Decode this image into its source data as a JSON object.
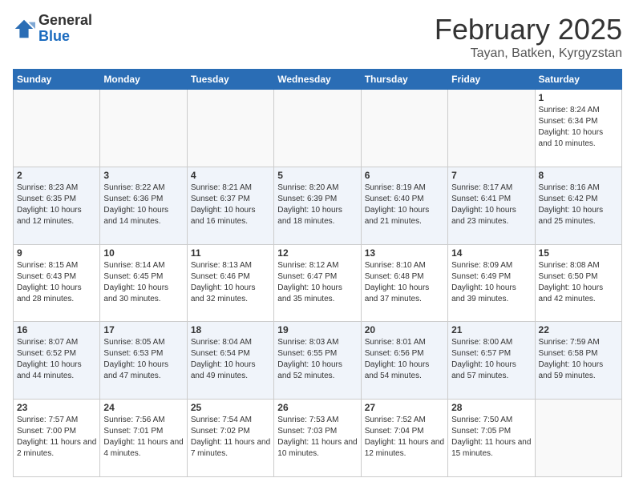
{
  "header": {
    "logo_general": "General",
    "logo_blue": "Blue",
    "month_title": "February 2025",
    "location": "Tayan, Batken, Kyrgyzstan"
  },
  "days_of_week": [
    "Sunday",
    "Monday",
    "Tuesday",
    "Wednesday",
    "Thursday",
    "Friday",
    "Saturday"
  ],
  "weeks": [
    {
      "alt": false,
      "days": [
        {
          "date": "",
          "info": ""
        },
        {
          "date": "",
          "info": ""
        },
        {
          "date": "",
          "info": ""
        },
        {
          "date": "",
          "info": ""
        },
        {
          "date": "",
          "info": ""
        },
        {
          "date": "",
          "info": ""
        },
        {
          "date": "1",
          "info": "Sunrise: 8:24 AM\nSunset: 6:34 PM\nDaylight: 10 hours\nand 10 minutes."
        }
      ]
    },
    {
      "alt": true,
      "days": [
        {
          "date": "2",
          "info": "Sunrise: 8:23 AM\nSunset: 6:35 PM\nDaylight: 10 hours\nand 12 minutes."
        },
        {
          "date": "3",
          "info": "Sunrise: 8:22 AM\nSunset: 6:36 PM\nDaylight: 10 hours\nand 14 minutes."
        },
        {
          "date": "4",
          "info": "Sunrise: 8:21 AM\nSunset: 6:37 PM\nDaylight: 10 hours\nand 16 minutes."
        },
        {
          "date": "5",
          "info": "Sunrise: 8:20 AM\nSunset: 6:39 PM\nDaylight: 10 hours\nand 18 minutes."
        },
        {
          "date": "6",
          "info": "Sunrise: 8:19 AM\nSunset: 6:40 PM\nDaylight: 10 hours\nand 21 minutes."
        },
        {
          "date": "7",
          "info": "Sunrise: 8:17 AM\nSunset: 6:41 PM\nDaylight: 10 hours\nand 23 minutes."
        },
        {
          "date": "8",
          "info": "Sunrise: 8:16 AM\nSunset: 6:42 PM\nDaylight: 10 hours\nand 25 minutes."
        }
      ]
    },
    {
      "alt": false,
      "days": [
        {
          "date": "9",
          "info": "Sunrise: 8:15 AM\nSunset: 6:43 PM\nDaylight: 10 hours\nand 28 minutes."
        },
        {
          "date": "10",
          "info": "Sunrise: 8:14 AM\nSunset: 6:45 PM\nDaylight: 10 hours\nand 30 minutes."
        },
        {
          "date": "11",
          "info": "Sunrise: 8:13 AM\nSunset: 6:46 PM\nDaylight: 10 hours\nand 32 minutes."
        },
        {
          "date": "12",
          "info": "Sunrise: 8:12 AM\nSunset: 6:47 PM\nDaylight: 10 hours\nand 35 minutes."
        },
        {
          "date": "13",
          "info": "Sunrise: 8:10 AM\nSunset: 6:48 PM\nDaylight: 10 hours\nand 37 minutes."
        },
        {
          "date": "14",
          "info": "Sunrise: 8:09 AM\nSunset: 6:49 PM\nDaylight: 10 hours\nand 39 minutes."
        },
        {
          "date": "15",
          "info": "Sunrise: 8:08 AM\nSunset: 6:50 PM\nDaylight: 10 hours\nand 42 minutes."
        }
      ]
    },
    {
      "alt": true,
      "days": [
        {
          "date": "16",
          "info": "Sunrise: 8:07 AM\nSunset: 6:52 PM\nDaylight: 10 hours\nand 44 minutes."
        },
        {
          "date": "17",
          "info": "Sunrise: 8:05 AM\nSunset: 6:53 PM\nDaylight: 10 hours\nand 47 minutes."
        },
        {
          "date": "18",
          "info": "Sunrise: 8:04 AM\nSunset: 6:54 PM\nDaylight: 10 hours\nand 49 minutes."
        },
        {
          "date": "19",
          "info": "Sunrise: 8:03 AM\nSunset: 6:55 PM\nDaylight: 10 hours\nand 52 minutes."
        },
        {
          "date": "20",
          "info": "Sunrise: 8:01 AM\nSunset: 6:56 PM\nDaylight: 10 hours\nand 54 minutes."
        },
        {
          "date": "21",
          "info": "Sunrise: 8:00 AM\nSunset: 6:57 PM\nDaylight: 10 hours\nand 57 minutes."
        },
        {
          "date": "22",
          "info": "Sunrise: 7:59 AM\nSunset: 6:58 PM\nDaylight: 10 hours\nand 59 minutes."
        }
      ]
    },
    {
      "alt": false,
      "days": [
        {
          "date": "23",
          "info": "Sunrise: 7:57 AM\nSunset: 7:00 PM\nDaylight: 11 hours\nand 2 minutes."
        },
        {
          "date": "24",
          "info": "Sunrise: 7:56 AM\nSunset: 7:01 PM\nDaylight: 11 hours\nand 4 minutes."
        },
        {
          "date": "25",
          "info": "Sunrise: 7:54 AM\nSunset: 7:02 PM\nDaylight: 11 hours\nand 7 minutes."
        },
        {
          "date": "26",
          "info": "Sunrise: 7:53 AM\nSunset: 7:03 PM\nDaylight: 11 hours\nand 10 minutes."
        },
        {
          "date": "27",
          "info": "Sunrise: 7:52 AM\nSunset: 7:04 PM\nDaylight: 11 hours\nand 12 minutes."
        },
        {
          "date": "28",
          "info": "Sunrise: 7:50 AM\nSunset: 7:05 PM\nDaylight: 11 hours\nand 15 minutes."
        },
        {
          "date": "",
          "info": ""
        }
      ]
    }
  ]
}
